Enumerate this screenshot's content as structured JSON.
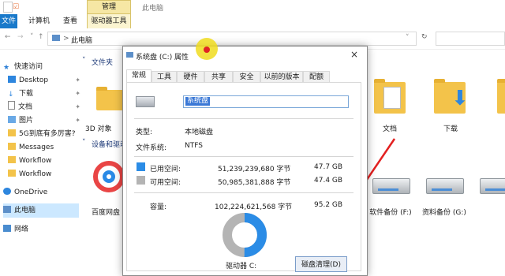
{
  "ribbon": {
    "title": "此电脑",
    "manage_tab": "管理",
    "file_tab": "文件",
    "tabs": [
      "计算机",
      "查看"
    ],
    "drive_tools": "驱动器工具"
  },
  "address": {
    "path": "此电脑",
    "sep": ">"
  },
  "nav": {
    "items": [
      {
        "label": "快速访问"
      },
      {
        "label": "Desktop"
      },
      {
        "label": "下载"
      },
      {
        "label": "文档"
      },
      {
        "label": "图片"
      },
      {
        "label": "5G到底有多厉害?"
      },
      {
        "label": "Messages"
      },
      {
        "label": "Workflow"
      },
      {
        "label": "Workflow"
      },
      {
        "label": "OneDrive"
      },
      {
        "label": "此电脑"
      },
      {
        "label": "网络"
      }
    ],
    "pin_glyph": "✦"
  },
  "content": {
    "folders_header": "文件夹",
    "devices_header": "设备和驱动",
    "folders": [
      {
        "label": "3D 对象"
      },
      {
        "label": "文档"
      },
      {
        "label": "下载"
      }
    ],
    "drives": [
      {
        "label": "百度网盘"
      },
      {
        "label": "软件备份 (F:)"
      },
      {
        "label": "资料备份 (G:)"
      }
    ]
  },
  "dialog": {
    "title": "系统盘 (C:) 属性",
    "close": "×",
    "tabs": [
      "常规",
      "工具",
      "硬件",
      "共享",
      "安全",
      "以前的版本",
      "配额"
    ],
    "name_value": "系统盘",
    "type_label": "类型:",
    "type_value": "本地磁盘",
    "fs_label": "文件系统:",
    "fs_value": "NTFS",
    "used_label": "已用空间:",
    "used_bytes": "51,239,239,680 字节",
    "used_gb": "47.7 GB",
    "free_label": "可用空间:",
    "free_bytes": "50,985,381,888 字节",
    "free_gb": "47.4 GB",
    "cap_label": "容量:",
    "cap_bytes": "102,224,621,568 字节",
    "cap_gb": "95.2 GB",
    "drive_caption": "驱动器 C:",
    "cleanup_button": "磁盘清理(D)",
    "used_fraction": 0.501,
    "colors": {
      "used": "#2b8ce6",
      "free": "#b4b4b4"
    }
  }
}
